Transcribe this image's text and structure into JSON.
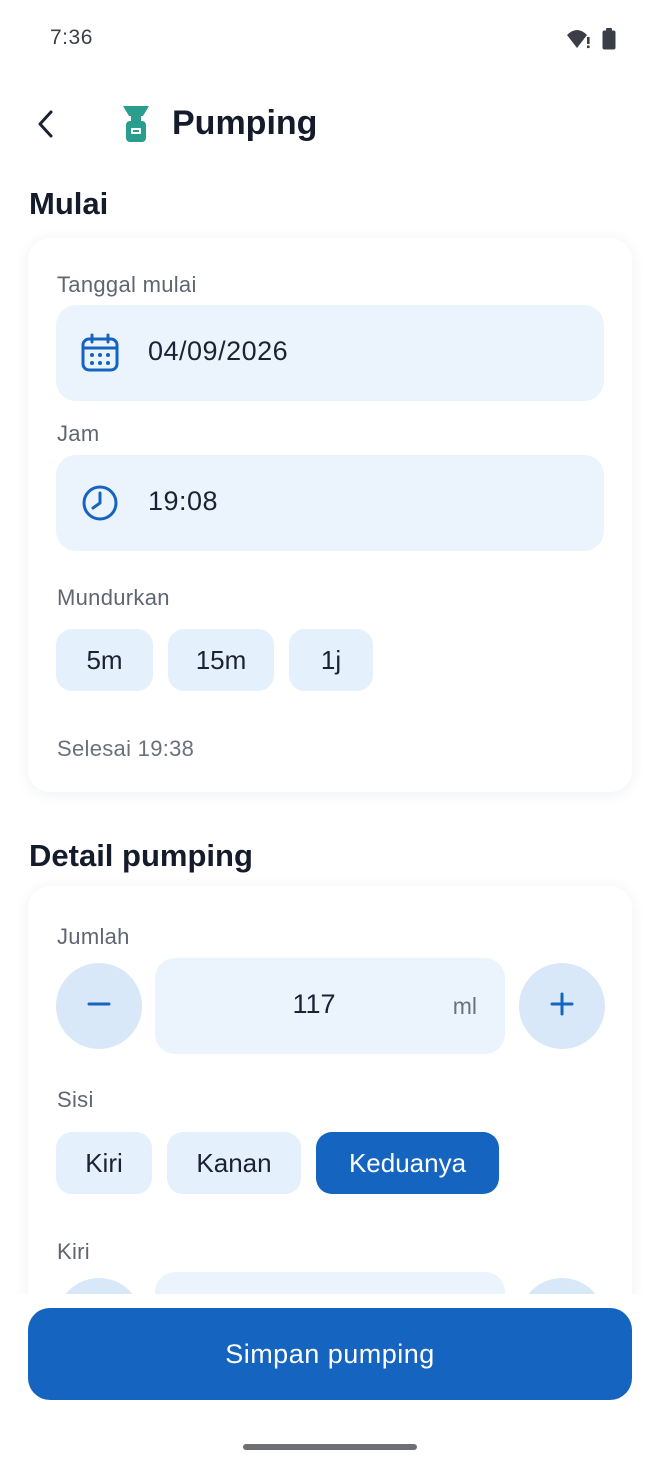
{
  "status_bar": {
    "time": "7:36",
    "icons": [
      "wifi-alert-icon",
      "battery-icon"
    ]
  },
  "app_bar": {
    "title": "Pumping",
    "back_icon": "chevron-left-icon",
    "app_icon": "breast-pump-icon"
  },
  "start_section": {
    "title": "Mulai",
    "date_label": "Tanggal mulai",
    "date_value": "04/09/2026",
    "time_label": "Jam",
    "time_value": "19:08",
    "shift_label": "Mundurkan",
    "shift_options": [
      "5m",
      "15m",
      "1j"
    ],
    "end_text": "Selesai 19:38"
  },
  "detail_section": {
    "title": "Detail pumping",
    "amount_label": "Jumlah",
    "amount_value": "117",
    "amount_unit": "ml",
    "side_label": "Sisi",
    "side_options": [
      "Kiri",
      "Kanan",
      "Keduanya"
    ],
    "side_selected": "Keduanya",
    "left_label": "Kiri"
  },
  "save_button": {
    "label": "Simpan pumping"
  },
  "colors": {
    "primary": "#1565c0",
    "field_bg": "#ebf4fd",
    "chip_bg": "#e4f0fb",
    "round_btn_bg": "#d9e8f8",
    "app_icon_teal": "#2a9d8f"
  }
}
